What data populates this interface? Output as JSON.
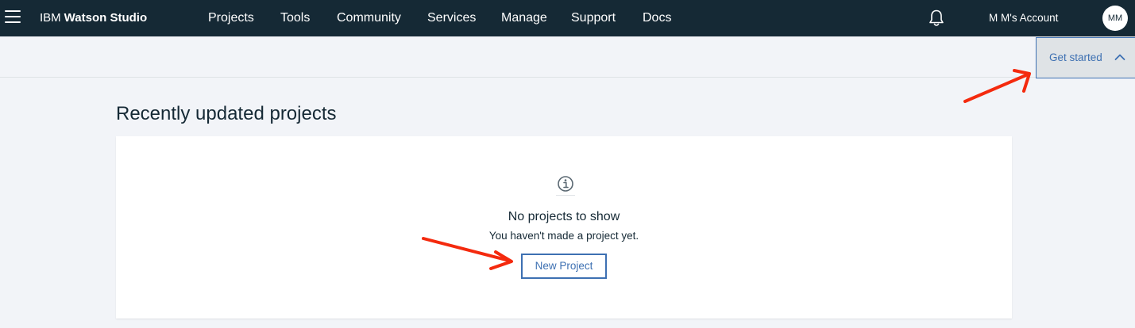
{
  "header": {
    "brand_prefix": "IBM",
    "brand_name": "Watson Studio",
    "nav": [
      {
        "label": "Projects"
      },
      {
        "label": "Tools"
      },
      {
        "label": "Community"
      },
      {
        "label": "Services"
      },
      {
        "label": "Manage"
      },
      {
        "label": "Support"
      },
      {
        "label": "Docs"
      }
    ],
    "account_label": "M M's Account",
    "avatar_initials": "MM",
    "icons": {
      "menu": "hamburger-menu-icon",
      "notifications": "bell-icon"
    }
  },
  "subbar": {
    "get_started_label": "Get started",
    "get_started_icon": "chevron-up-icon"
  },
  "main": {
    "section_title": "Recently updated projects",
    "empty_state": {
      "icon": "info-icon",
      "title": "No projects to show",
      "subtitle": "You haven't made a project yet.",
      "button_label": "New Project"
    }
  },
  "colors": {
    "topbar_bg": "#152935",
    "page_bg": "#f2f4f8",
    "accent_blue": "#3d70b2",
    "annotation_red": "#f42a0e"
  }
}
